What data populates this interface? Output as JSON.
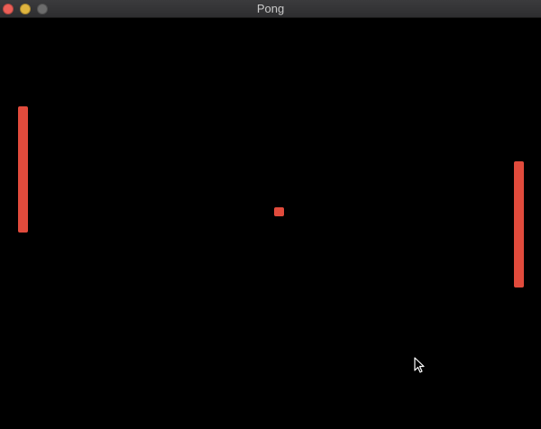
{
  "window": {
    "title": "Pong",
    "controls": {
      "close_color": "#ec5f57",
      "minimize_color": "#e0b53f",
      "zoom_color": "#6c6c6c"
    }
  },
  "game": {
    "background_color": "#000000",
    "object_color": "#e14b3c",
    "objects": [
      "left-paddle",
      "right-paddle",
      "ball"
    ]
  },
  "pointer": {
    "icon": "arrow-cursor-icon"
  }
}
